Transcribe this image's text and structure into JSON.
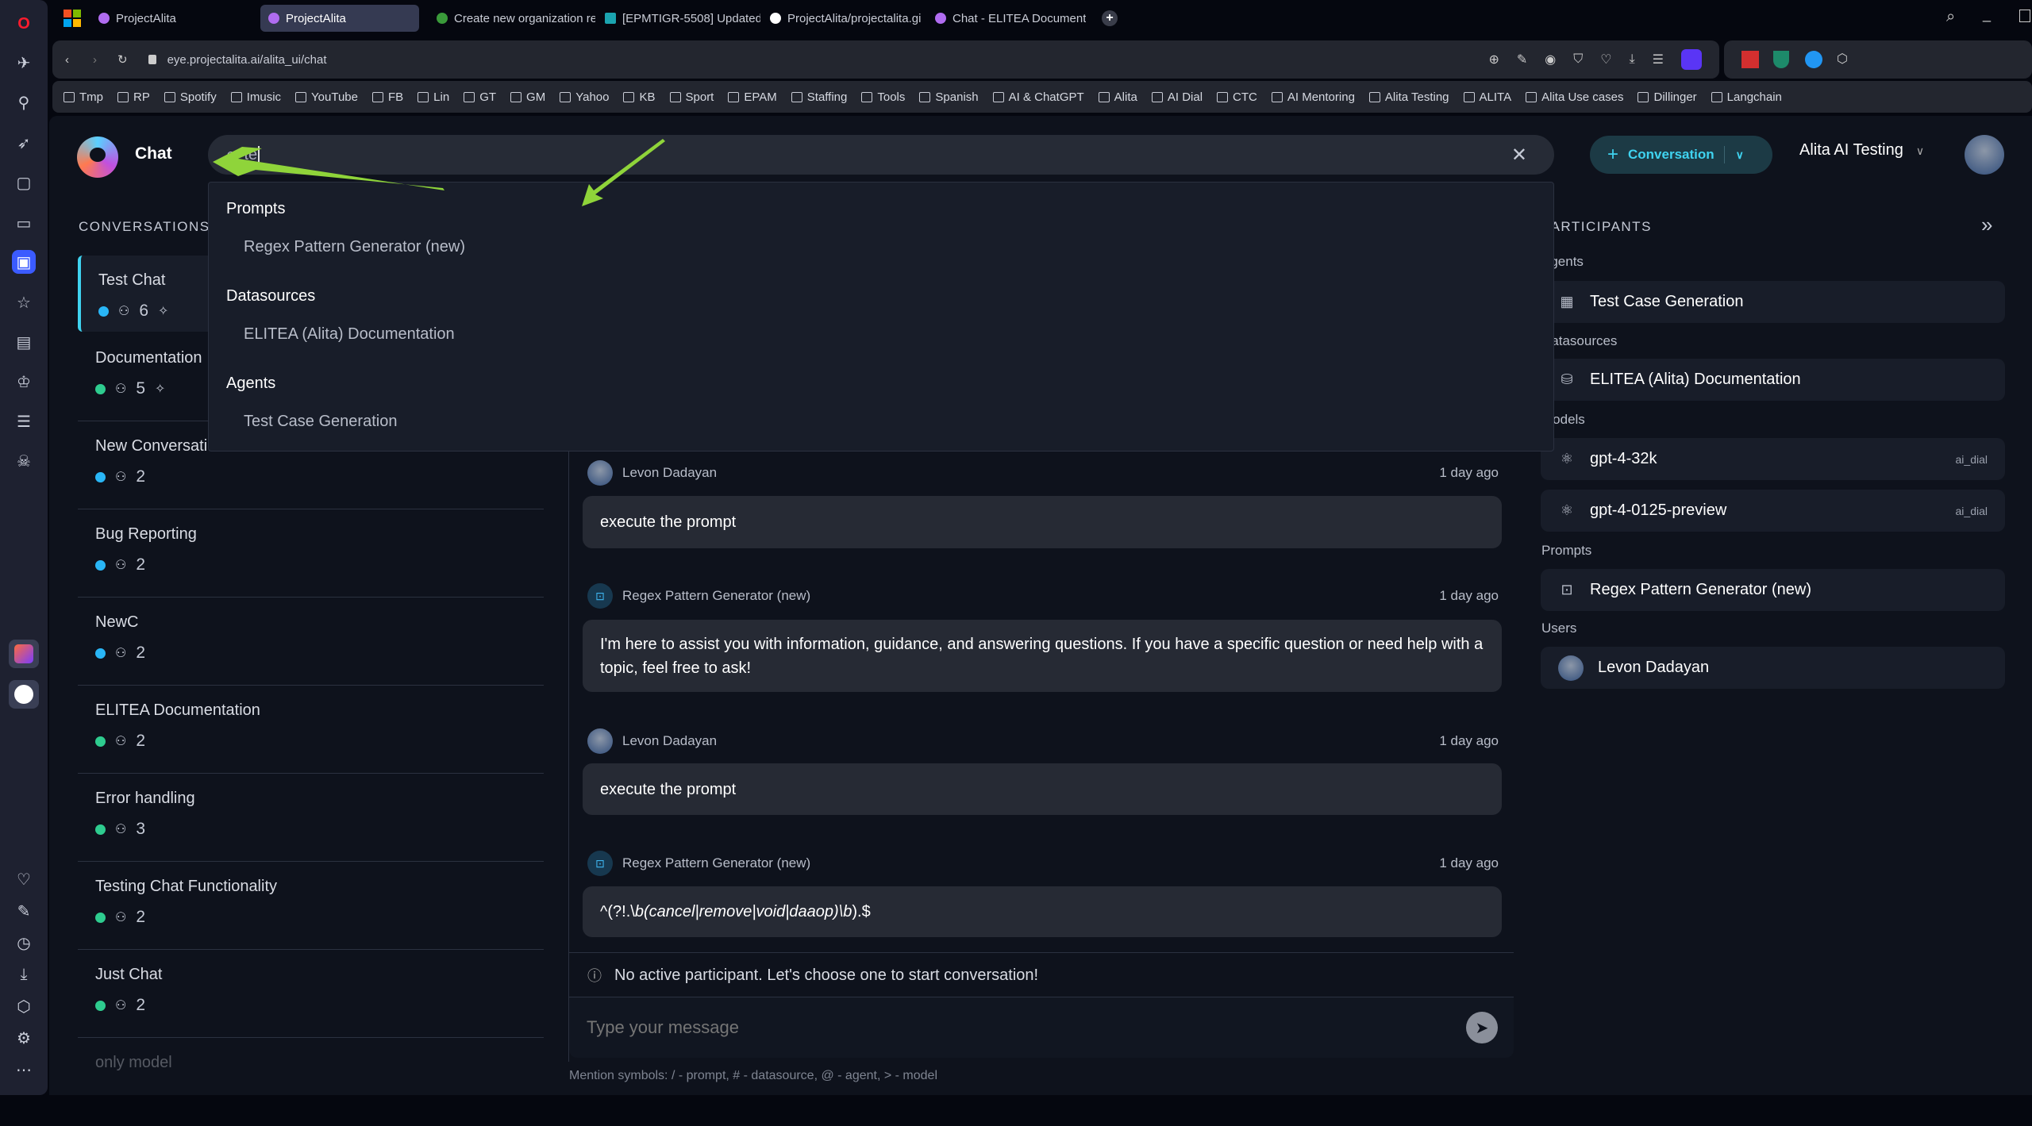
{
  "browser": {
    "tabs": [
      {
        "label": "ProjectAlita"
      },
      {
        "label": "ProjectAlita",
        "active": true
      },
      {
        "label": "Create new organization re"
      },
      {
        "label": "[EPMTIGR-5508] Updated:"
      },
      {
        "label": "ProjectAlita/projectalita.gi"
      },
      {
        "label": "Chat - ELITEA Documentat"
      }
    ],
    "url": "eye.projectalita.ai/alita_ui/chat",
    "bookmarks": [
      "Tmp",
      "RP",
      "Spotify",
      "Imusic",
      "YouTube",
      "FB",
      "Lin",
      "GT",
      "GM",
      "Yahoo",
      "KB",
      "Sport",
      "EPAM",
      "Staffing",
      "Tools",
      "Spanish",
      "AI & ChatGPT",
      "Alita",
      "AI Dial",
      "CTC",
      "AI Mentoring",
      "Alita Testing",
      "ALITA",
      "Alita Use cases",
      "Dillinger",
      "Langchain"
    ]
  },
  "header": {
    "title": "Chat",
    "search_value": "te",
    "new_conversation_label": "Conversation",
    "project": "Alita AI Testing"
  },
  "search_results": {
    "groups": [
      {
        "title": "Prompts",
        "items": [
          "Regex Pattern Generator (new)"
        ]
      },
      {
        "title": "Datasources",
        "items": [
          "ELITEA (Alita) Documentation"
        ]
      },
      {
        "title": "Agents",
        "items": [
          "Test Case Generation"
        ]
      }
    ]
  },
  "conversations": {
    "label": "CONVERSATIONS",
    "items": [
      {
        "title": "Test Chat",
        "participants": "6",
        "pinned": true,
        "status_color": "#29b6f6"
      },
      {
        "title": "Documentation",
        "participants": "5",
        "pinned": true,
        "status_color": "#2ecc8f"
      },
      {
        "title": "New Conversation",
        "participants": "2",
        "status_color": "#29b6f6"
      },
      {
        "title": "Bug Reporting",
        "participants": "2",
        "status_color": "#29b6f6"
      },
      {
        "title": "NewC",
        "participants": "2",
        "status_color": "#29b6f6"
      },
      {
        "title": "ELITEA Documentation",
        "participants": "2",
        "status_color": "#2ecc8f"
      },
      {
        "title": "Error handling",
        "participants": "3",
        "status_color": "#2ecc8f"
      },
      {
        "title": "Testing Chat Functionality",
        "participants": "2",
        "status_color": "#2ecc8f"
      },
      {
        "title": "Just Chat",
        "participants": "2",
        "status_color": "#2ecc8f"
      },
      {
        "title": "only model"
      }
    ]
  },
  "messages": [
    {
      "author": "Levon Dadayan",
      "time": "1 day ago",
      "text": "execute the prompt"
    },
    {
      "author": "Regex Pattern Generator (new)",
      "time": "1 day ago",
      "text": "I'm here to assist you with information, guidance, and answering questions. If you have a specific question or need help with a topic, feel free to ask!"
    },
    {
      "author": "Levon Dadayan",
      "time": "1 day ago",
      "text": "execute the prompt"
    },
    {
      "author": "Regex Pattern Generator (new)",
      "time": "1 day ago",
      "text_prefix": "^(?!.\\",
      "text_italic": "b(cancel|remove|void|daaop)\\b",
      "text_suffix": ").$"
    }
  ],
  "notice": "No active participant. Let's choose one to start conversation!",
  "input": {
    "placeholder": "Type your message"
  },
  "hint": "Mention symbols: / - prompt, # - datasource, @ - agent, > - model",
  "participants": {
    "title": "PARTICIPANTS",
    "agents_label": "Agents",
    "agents": [
      "Test Case Generation"
    ],
    "datasources_label": "Datasources",
    "datasources": [
      "ELITEA (Alita) Documentation"
    ],
    "models_label": "Models",
    "models": [
      {
        "name": "gpt-4-32k",
        "provider": "ai_dial"
      },
      {
        "name": "gpt-4-0125-preview",
        "provider": "ai_dial"
      }
    ],
    "prompts_label": "Prompts",
    "prompts": [
      "Regex Pattern Generator (new)"
    ],
    "users_label": "Users",
    "users": [
      "Levon Dadayan"
    ]
  },
  "colors": {
    "accent": "#3fd3f0",
    "annotation_arrow": "#8fd43a"
  }
}
